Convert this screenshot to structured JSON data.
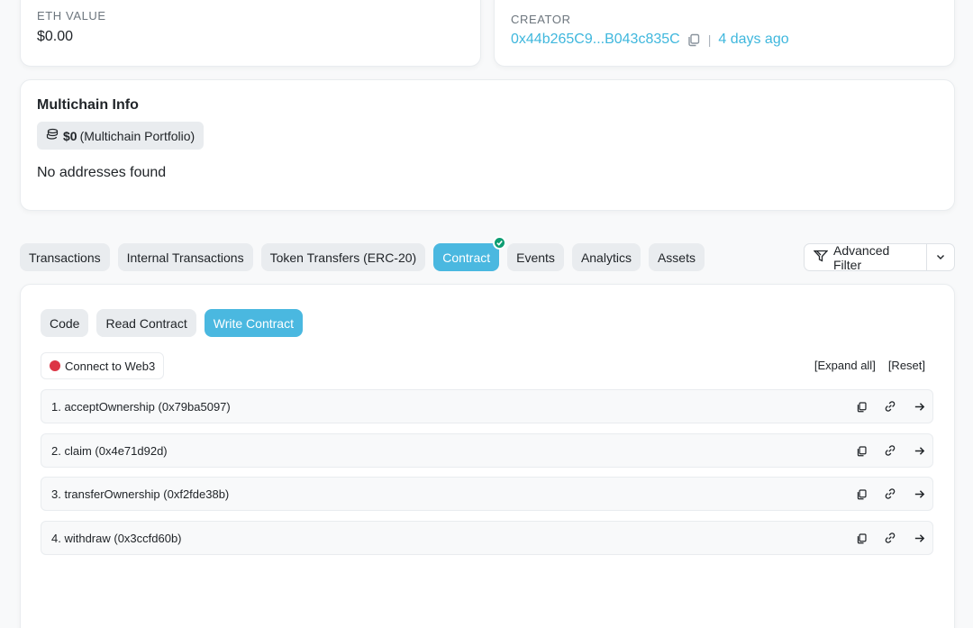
{
  "eth_card": {
    "label": "ETH VALUE",
    "value": "$0.00"
  },
  "creator_card": {
    "label": "CREATOR",
    "address": "0x44b265C9...B043c835C",
    "time": "4 days ago"
  },
  "multichain": {
    "title": "Multichain Info",
    "portfolio_value": "$0",
    "portfolio_label": "(Multichain Portfolio)",
    "empty_text": "No addresses found"
  },
  "tabs": [
    {
      "label": "Transactions"
    },
    {
      "label": "Internal Transactions"
    },
    {
      "label": "Token Transfers (ERC-20)"
    },
    {
      "label": "Contract"
    },
    {
      "label": "Events"
    },
    {
      "label": "Analytics"
    },
    {
      "label": "Assets"
    }
  ],
  "advanced_filter": {
    "label": "Advanced Filter"
  },
  "contract": {
    "subtabs": [
      {
        "label": "Code"
      },
      {
        "label": "Read Contract"
      },
      {
        "label": "Write Contract"
      }
    ],
    "connect_label": "Connect to Web3",
    "expand_all": "[Expand all]",
    "reset": "[Reset]",
    "functions": [
      {
        "label": "1. acceptOwnership (0x79ba5097)"
      },
      {
        "label": "2. claim (0x4e71d92d)"
      },
      {
        "label": "3. transferOwnership (0xf2fde38b)"
      },
      {
        "label": "4. withdraw (0x3ccfd60b)"
      }
    ]
  },
  "colors": {
    "accent": "#4ab8e0",
    "link": "#3fb7dd",
    "success": "#0d9d72",
    "danger": "#dc3545"
  }
}
